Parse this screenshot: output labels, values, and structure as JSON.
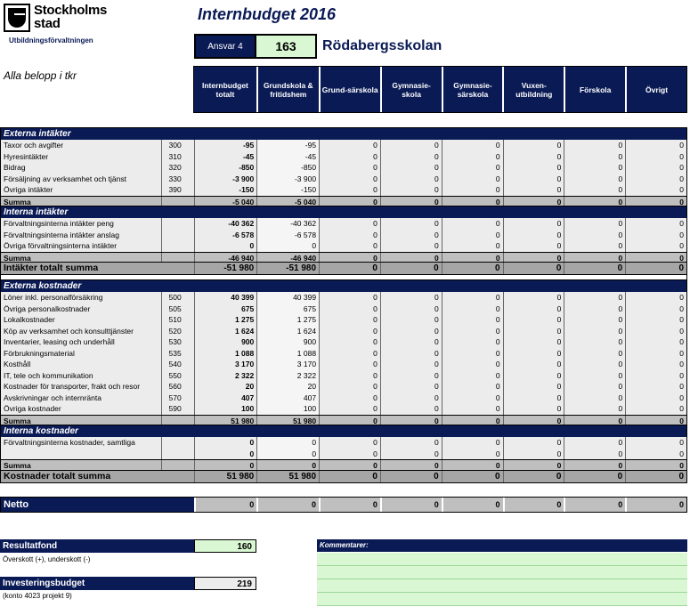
{
  "header": {
    "logo_line1": "Stockholms",
    "logo_line2": "stad",
    "org": "Utbildningsförvaltningen",
    "title": "Internbudget 2016",
    "ansvar_label": "Ansvar 4",
    "ansvar_number": "163",
    "school": "Rödabergsskolan",
    "belopp_note": "Alla belopp i tkr"
  },
  "columns": [
    "Internbudget totalt",
    "Grundskola & fritidshem",
    "Grund-särskola",
    "Gymnasie-skola",
    "Gymnasie-särskola",
    "Vuxen-utbildning",
    "Förskola",
    "Övrigt"
  ],
  "rows": [
    {
      "type": "sec",
      "label": "Externa intäkter"
    },
    {
      "type": "data",
      "label": "Taxor och avgifter",
      "code": "300",
      "values": [
        "-95",
        "-95",
        "0",
        "0",
        "0",
        "0",
        "0",
        "0"
      ]
    },
    {
      "type": "data",
      "label": "Hyresintäkter",
      "code": "310",
      "values": [
        "-45",
        "-45",
        "0",
        "0",
        "0",
        "0",
        "0",
        "0"
      ]
    },
    {
      "type": "data",
      "label": "Bidrag",
      "code": "320",
      "values": [
        "-850",
        "-850",
        "0",
        "0",
        "0",
        "0",
        "0",
        "0"
      ]
    },
    {
      "type": "data",
      "label": "Försäljning av verksamhet och tjänst",
      "code": "330",
      "values": [
        "-3 900",
        "-3 900",
        "0",
        "0",
        "0",
        "0",
        "0",
        "0"
      ]
    },
    {
      "type": "data",
      "label": "Övriga intäkter",
      "code": "390",
      "values": [
        "-150",
        "-150",
        "0",
        "0",
        "0",
        "0",
        "0",
        "0"
      ]
    },
    {
      "type": "sum",
      "label": "Summa",
      "code": "",
      "values": [
        "-5 040",
        "-5 040",
        "0",
        "0",
        "0",
        "0",
        "0",
        "0"
      ]
    },
    {
      "type": "sec",
      "label": "Interna intäkter"
    },
    {
      "type": "data",
      "label": "Förvaltningsinterna intäkter peng",
      "code": "",
      "values": [
        "-40 362",
        "-40 362",
        "0",
        "0",
        "0",
        "0",
        "0",
        "0"
      ]
    },
    {
      "type": "data",
      "label": "Förvaltningsinterna intäkter anslag",
      "code": "",
      "values": [
        "-6 578",
        "-6 578",
        "0",
        "0",
        "0",
        "0",
        "0",
        "0"
      ]
    },
    {
      "type": "data",
      "label": "Övriga förvaltningsinterna intäkter",
      "code": "",
      "values": [
        "0",
        "0",
        "0",
        "0",
        "0",
        "0",
        "0",
        "0"
      ]
    },
    {
      "type": "sum",
      "label": "Summa",
      "code": "",
      "values": [
        "-46 940",
        "-46 940",
        "0",
        "0",
        "0",
        "0",
        "0",
        "0"
      ]
    },
    {
      "type": "total",
      "label": "Intäkter totalt summa",
      "code": "",
      "values": [
        "-51 980",
        "-51 980",
        "0",
        "0",
        "0",
        "0",
        "0",
        "0"
      ]
    },
    {
      "type": "spacer"
    },
    {
      "type": "sec",
      "label": "Externa kostnader"
    },
    {
      "type": "data",
      "label": "Löner inkl. personalförsäkring",
      "code": "500",
      "values": [
        "40 399",
        "40 399",
        "0",
        "0",
        "0",
        "0",
        "0",
        "0"
      ]
    },
    {
      "type": "data",
      "label": "Övriga personalkostnader",
      "code": "505",
      "values": [
        "675",
        "675",
        "0",
        "0",
        "0",
        "0",
        "0",
        "0"
      ]
    },
    {
      "type": "data",
      "label": "Lokalkostnader",
      "code": "510",
      "values": [
        "1 275",
        "1 275",
        "0",
        "0",
        "0",
        "0",
        "0",
        "0"
      ]
    },
    {
      "type": "data",
      "label": "Köp av verksamhet och konsulttjänster",
      "code": "520",
      "values": [
        "1 624",
        "1 624",
        "0",
        "0",
        "0",
        "0",
        "0",
        "0"
      ]
    },
    {
      "type": "data",
      "label": "Inventarier, leasing och underhåll",
      "code": "530",
      "values": [
        "900",
        "900",
        "0",
        "0",
        "0",
        "0",
        "0",
        "0"
      ]
    },
    {
      "type": "data",
      "label": "Förbrukningsmaterial",
      "code": "535",
      "values": [
        "1 088",
        "1 088",
        "0",
        "0",
        "0",
        "0",
        "0",
        "0"
      ]
    },
    {
      "type": "data",
      "label": "Kosthåll",
      "code": "540",
      "values": [
        "3 170",
        "3 170",
        "0",
        "0",
        "0",
        "0",
        "0",
        "0"
      ]
    },
    {
      "type": "data",
      "label": "IT, tele och kommunikation",
      "code": "550",
      "values": [
        "2 322",
        "2 322",
        "0",
        "0",
        "0",
        "0",
        "0",
        "0"
      ]
    },
    {
      "type": "data",
      "label": "Kostnader för transporter, frakt och resor",
      "code": "560",
      "values": [
        "20",
        "20",
        "0",
        "0",
        "0",
        "0",
        "0",
        "0"
      ]
    },
    {
      "type": "data",
      "label": "Avskrivningar och internränta",
      "code": "570",
      "values": [
        "407",
        "407",
        "0",
        "0",
        "0",
        "0",
        "0",
        "0"
      ]
    },
    {
      "type": "data",
      "label": "Övriga kostnader",
      "code": "590",
      "values": [
        "100",
        "100",
        "0",
        "0",
        "0",
        "0",
        "0",
        "0"
      ]
    },
    {
      "type": "sum",
      "label": "Summa",
      "code": "",
      "values": [
        "51 980",
        "51 980",
        "0",
        "0",
        "0",
        "0",
        "0",
        "0"
      ]
    },
    {
      "type": "sec",
      "label": "Interna kostnader"
    },
    {
      "type": "data",
      "label": "Förvaltningsinterna kostnader, samtliga",
      "code": "",
      "values": [
        "0",
        "0",
        "0",
        "0",
        "0",
        "0",
        "0",
        "0"
      ]
    },
    {
      "type": "data",
      "label": "",
      "code": "",
      "values": [
        "0",
        "0",
        "0",
        "0",
        "0",
        "0",
        "0",
        "0"
      ]
    },
    {
      "type": "sum",
      "label": "Summa",
      "code": "",
      "values": [
        "0",
        "0",
        "0",
        "0",
        "0",
        "0",
        "0",
        "0"
      ]
    },
    {
      "type": "total",
      "label": "Kostnader totalt summa",
      "code": "",
      "values": [
        "51 980",
        "51 980",
        "0",
        "0",
        "0",
        "0",
        "0",
        "0"
      ]
    }
  ],
  "netto": {
    "label": "Netto",
    "values": [
      "0",
      "0",
      "0",
      "0",
      "0",
      "0",
      "0",
      "0"
    ]
  },
  "resultatfond": {
    "label": "Resultatfond",
    "value": "160",
    "note": "Överskott (+), underskott (-)"
  },
  "investering": {
    "label": "Investeringsbudget",
    "value": "219",
    "note": "(konto 4023 projekt 9)"
  },
  "kommentarer": {
    "label": "Kommentarer:"
  },
  "colors": {
    "navy": "#0a1a55",
    "green": "#d9f7d3",
    "grey": "#bfbfbf"
  }
}
